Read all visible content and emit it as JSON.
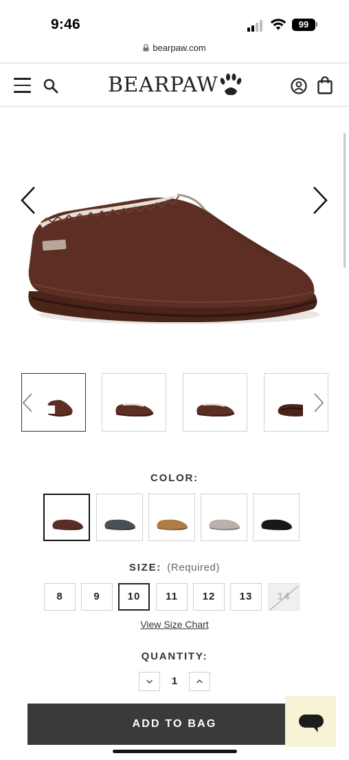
{
  "status_bar": {
    "time": "9:46",
    "battery": "99",
    "icons": [
      "signal-icon",
      "wifi-icon",
      "battery-icon"
    ]
  },
  "browser": {
    "url": "bearpaw.com",
    "icon": "lock-icon"
  },
  "header": {
    "brand": "BEARPAW",
    "icons": [
      "menu-icon",
      "search-icon",
      "paw-logo-icon",
      "account-icon",
      "bag-icon"
    ]
  },
  "product": {
    "hero_nav_icons": [
      "chevron-left-icon",
      "chevron-right-icon"
    ],
    "thumbnail_count": 4,
    "active_thumbnail": 1,
    "main_color": "#5a2e24"
  },
  "color": {
    "label": "COLOR:",
    "swatches": [
      {
        "name": "chocolate",
        "hex": "#5a2e24",
        "selected": true
      },
      {
        "name": "charcoal",
        "hex": "#4a4e57",
        "selected": false
      },
      {
        "name": "hickory",
        "hex": "#b07d47",
        "selected": false
      },
      {
        "name": "gray fog",
        "hex": "#b9b1ad",
        "selected": false
      },
      {
        "name": "black",
        "hex": "#1a1714",
        "selected": false
      }
    ]
  },
  "size": {
    "label": "SIZE:",
    "required": "(Required)",
    "options": [
      {
        "label": "8",
        "state": "available"
      },
      {
        "label": "9",
        "state": "available"
      },
      {
        "label": "10",
        "state": "selected"
      },
      {
        "label": "11",
        "state": "available"
      },
      {
        "label": "12",
        "state": "available"
      },
      {
        "label": "13",
        "state": "available"
      },
      {
        "label": "14",
        "state": "unavailable"
      }
    ],
    "size_chart_link": "View Size Chart"
  },
  "quantity": {
    "label": "QUANTITY:",
    "value": "1",
    "icons": [
      "chevron-down-icon",
      "chevron-up-icon"
    ]
  },
  "cta": {
    "add_to_bag": "ADD TO BAG"
  },
  "chat": {
    "icon": "chat-bubble-icon",
    "background": "#f7f4d6"
  }
}
